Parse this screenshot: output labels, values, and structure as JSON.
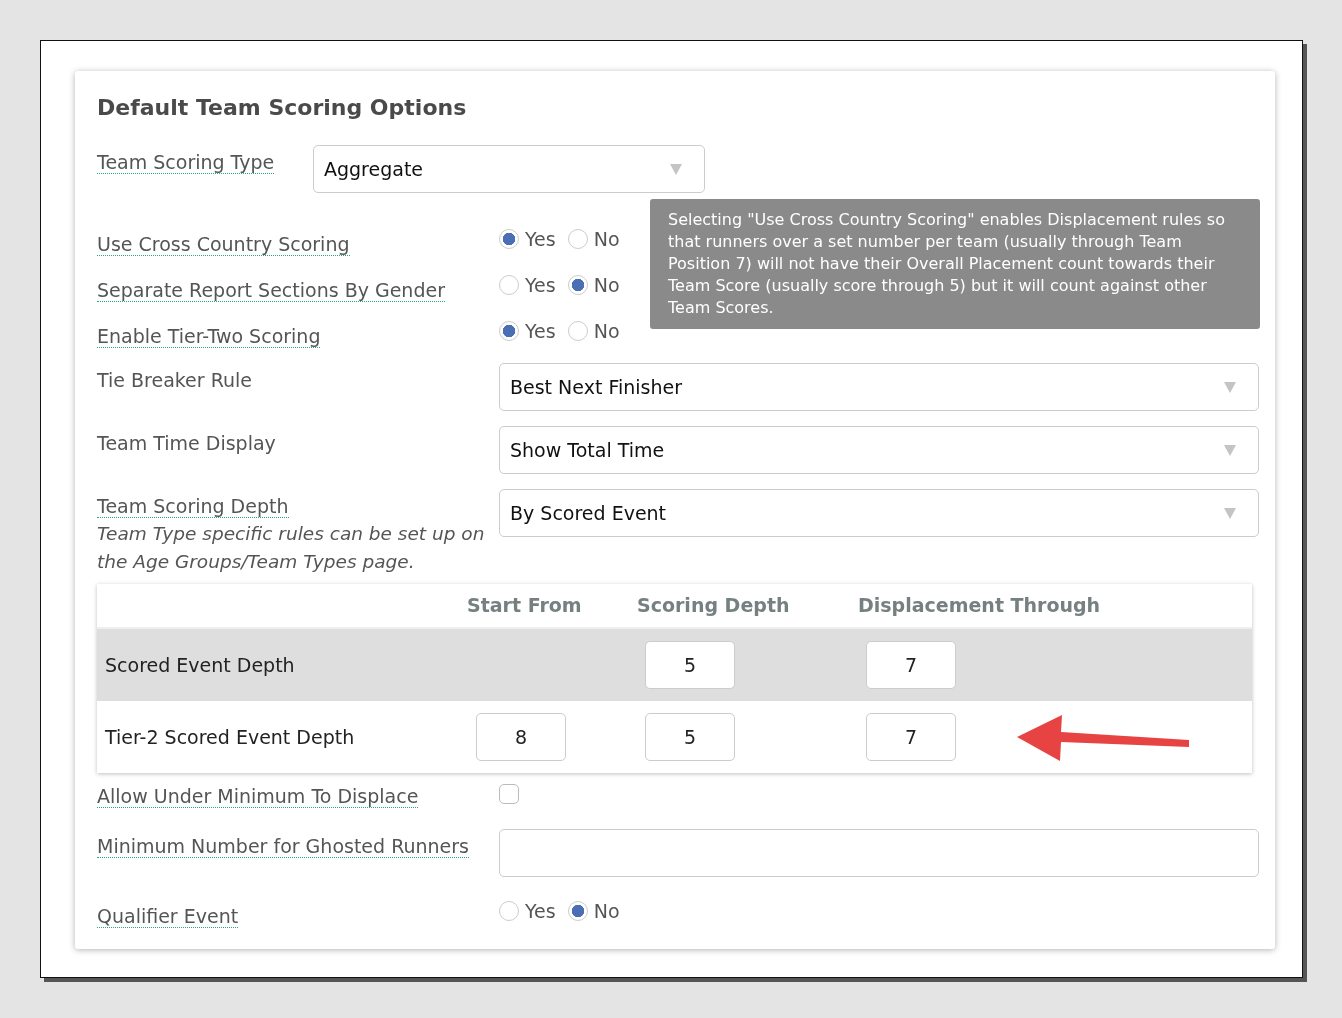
{
  "title": "Default Team Scoring Options",
  "fields": [
    {
      "kind": "compact-select",
      "label": "Team Scoring Type",
      "underlined": true,
      "value": "Aggregate"
    },
    {
      "kind": "radio",
      "label": "Use Cross Country Scoring",
      "underlined": true,
      "options": [
        {
          "label": "Yes",
          "selected": true
        },
        {
          "label": "No",
          "selected": false
        }
      ]
    },
    {
      "kind": "radio",
      "label": "Separate Report Sections By Gender",
      "underlined": true,
      "options": [
        {
          "label": "Yes",
          "selected": false
        },
        {
          "label": "No",
          "selected": true
        }
      ]
    },
    {
      "kind": "radio",
      "label": "Enable Tier-Two Scoring",
      "underlined": true,
      "options": [
        {
          "label": "Yes",
          "selected": true
        },
        {
          "label": "No",
          "selected": false
        }
      ]
    },
    {
      "kind": "select",
      "label": "Tie Breaker Rule",
      "underlined": false,
      "value": "Best Next Finisher"
    },
    {
      "kind": "select",
      "label": "Team Time Display",
      "underlined": false,
      "value": "Show Total Time"
    },
    {
      "kind": "select",
      "label": "Team Scoring Depth",
      "underlined": true,
      "note": "Team Type specific rules can be set up on the Age Groups/Team Types page.",
      "value": "By Scored Event"
    },
    {
      "kind": "table"
    },
    {
      "kind": "checkbox",
      "label": "Allow Under Minimum To Displace",
      "underlined": true,
      "checked": false
    },
    {
      "kind": "text",
      "label": "Minimum Number for Ghosted Runners",
      "underlined": true
    },
    {
      "kind": "radio",
      "label": "Qualifier Event",
      "underlined": true,
      "options": [
        {
          "label": "Yes",
          "selected": false
        },
        {
          "label": "No",
          "selected": true
        }
      ]
    }
  ],
  "table": {
    "columns": [
      "Start From",
      "Scoring Depth",
      "Displacement Through"
    ],
    "rows": [
      {
        "label": "Scored Event Depth",
        "selected": true,
        "cells": [
          "",
          "5",
          "7"
        ]
      },
      {
        "label": "Tier-2 Scored Event Depth",
        "selected": false,
        "cells": [
          "8",
          "5",
          "7"
        ]
      }
    ]
  },
  "tooltip": {
    "text": "Selecting \"Use Cross Country Scoring\" enables Displacement rules so that runners over a set number per team (usually through Team Position 7) will not have their Overall Placement count towards their Team Score (usually score through 5) but it will count against other Team Scores."
  }
}
